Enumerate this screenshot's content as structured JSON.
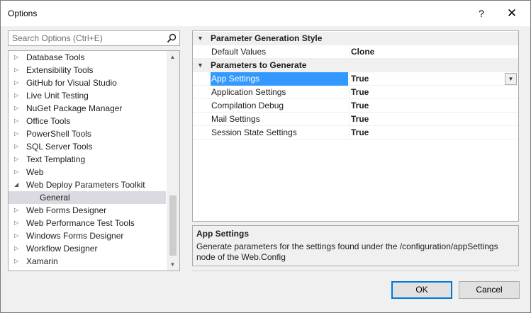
{
  "window": {
    "title": "Options",
    "help_glyph": "?",
    "close_glyph": "✕"
  },
  "search": {
    "placeholder": "Search Options (Ctrl+E)",
    "value": ""
  },
  "tree": {
    "items": [
      {
        "label": "Database Tools",
        "state": "collapsed"
      },
      {
        "label": "Extensibility Tools",
        "state": "collapsed"
      },
      {
        "label": "GitHub for Visual Studio",
        "state": "collapsed"
      },
      {
        "label": "Live Unit Testing",
        "state": "collapsed"
      },
      {
        "label": "NuGet Package Manager",
        "state": "collapsed"
      },
      {
        "label": "Office Tools",
        "state": "collapsed"
      },
      {
        "label": "PowerShell Tools",
        "state": "collapsed"
      },
      {
        "label": "SQL Server Tools",
        "state": "collapsed"
      },
      {
        "label": "Text Templating",
        "state": "collapsed"
      },
      {
        "label": "Web",
        "state": "collapsed"
      },
      {
        "label": "Web Deploy Parameters Toolkit",
        "state": "expanded"
      },
      {
        "label": "General",
        "state": "child-selected"
      },
      {
        "label": "Web Forms Designer",
        "state": "collapsed"
      },
      {
        "label": "Web Performance Test Tools",
        "state": "collapsed"
      },
      {
        "label": "Windows Forms Designer",
        "state": "collapsed"
      },
      {
        "label": "Workflow Designer",
        "state": "collapsed"
      },
      {
        "label": "Xamarin",
        "state": "collapsed"
      }
    ]
  },
  "grid": {
    "categories": [
      {
        "label": "Parameter Generation Style",
        "properties": [
          {
            "name": "Default Values",
            "value": "Clone"
          }
        ]
      },
      {
        "label": "Parameters to Generate",
        "properties": [
          {
            "name": "App Settings",
            "value": "True",
            "selected": true
          },
          {
            "name": "Application Settings",
            "value": "True"
          },
          {
            "name": "Compilation Debug",
            "value": "True"
          },
          {
            "name": "Mail Settings",
            "value": "True"
          },
          {
            "name": "Session State Settings",
            "value": "True"
          }
        ]
      }
    ]
  },
  "description": {
    "title": "App Settings",
    "text_line1": "Generate parameters for the settings found under the /configuration/appSettings",
    "text_line2": "node of the Web.Config"
  },
  "buttons": {
    "ok": "OK",
    "cancel": "Cancel"
  },
  "colors": {
    "selection": "#3399ff",
    "tree_selected": "#dadae0",
    "ok_border": "#0078d7"
  },
  "icons": {
    "search": "magnifier",
    "collapsed": "triangle-right",
    "expanded": "triangle-down",
    "dropdown": "chevron-down"
  }
}
